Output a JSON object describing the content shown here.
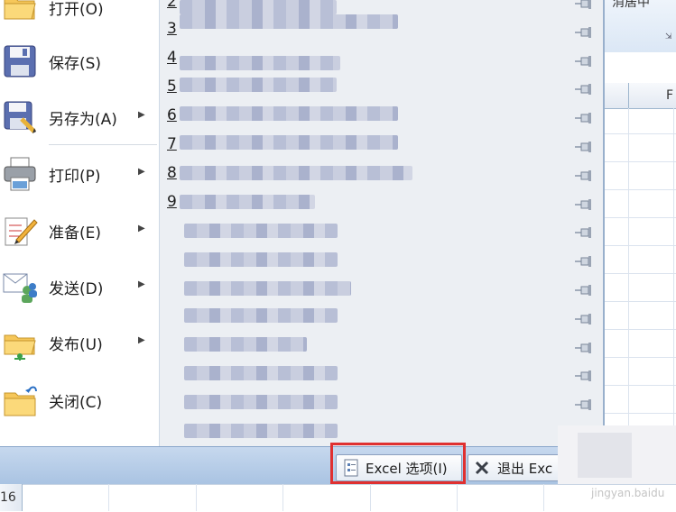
{
  "left_menu": [
    {
      "label": "打开(O)",
      "submenu": false,
      "icon": "folder-open-icon"
    },
    {
      "label": "保存(S)",
      "submenu": false,
      "icon": "floppy-disk-icon"
    },
    {
      "label": "另存为(A)",
      "submenu": true,
      "icon": "save-as-icon"
    },
    {
      "label": "打印(P)",
      "submenu": true,
      "icon": "printer-icon"
    },
    {
      "label": "准备(E)",
      "submenu": true,
      "icon": "prepare-pencil-icon"
    },
    {
      "label": "发送(D)",
      "submenu": true,
      "icon": "send-users-icon"
    },
    {
      "label": "发布(U)",
      "submenu": true,
      "icon": "publish-folder-icon"
    },
    {
      "label": "关闭(C)",
      "submenu": false,
      "icon": "close-folder-icon"
    }
  ],
  "recent_numbers": [
    "2",
    "3",
    "4",
    "5",
    "6",
    "7",
    "8",
    "9"
  ],
  "bottom_buttons": {
    "options": "Excel 选项(I)",
    "exit": "退出 Exc"
  },
  "sheet": {
    "ribbon_text": "消居中",
    "column_letter": "F",
    "row_number": "16"
  },
  "colors": {
    "highlight_border": "#e03030",
    "menu_pane": "#eceff3",
    "bottom_bar": "#b8cfe9"
  }
}
